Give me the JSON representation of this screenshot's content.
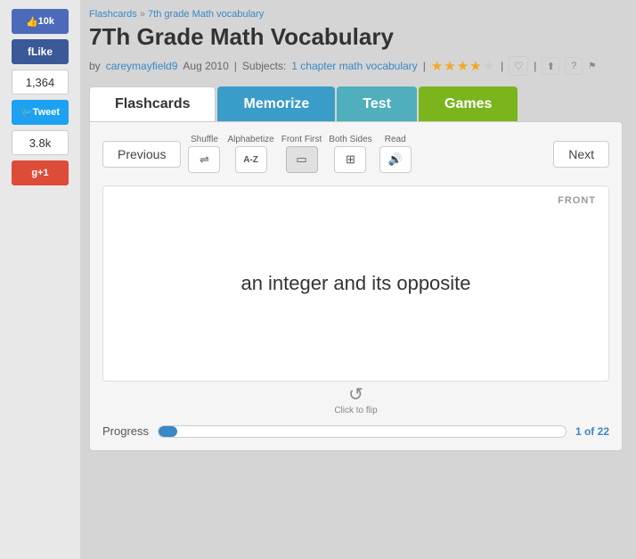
{
  "breadcrumb": {
    "home": "Flashcards",
    "separator": " » ",
    "current": "7th grade Math vocabulary"
  },
  "page": {
    "title": "7Th Grade Math Vocabulary",
    "author": "careymayfield9",
    "date": "Aug 2010",
    "subjects_label": "Subjects:",
    "subjects_link": "1 chapter math vocabulary",
    "stars_filled": 4,
    "stars_total": 5
  },
  "tabs": [
    {
      "id": "flashcards",
      "label": "Flashcards",
      "active": true
    },
    {
      "id": "memorize",
      "label": "Memorize",
      "active": false
    },
    {
      "id": "test",
      "label": "Test",
      "active": false
    },
    {
      "id": "games",
      "label": "Games",
      "active": false
    }
  ],
  "controls": {
    "previous_label": "Previous",
    "next_label": "Next",
    "shuffle_label": "Shuffle",
    "alphabetize_label": "Alphabetize",
    "front_first_label": "Front First",
    "both_sides_label": "Both Sides",
    "read_label": "Read"
  },
  "card": {
    "face_label": "FRONT",
    "content": "an integer and its opposite",
    "flip_label": "Click to flip"
  },
  "progress": {
    "label": "Progress",
    "current": "1",
    "separator": " of ",
    "total": "22"
  },
  "social": {
    "thumbs_count": "10k",
    "likes_count": "1,364",
    "tweets_count": "3.8k"
  }
}
